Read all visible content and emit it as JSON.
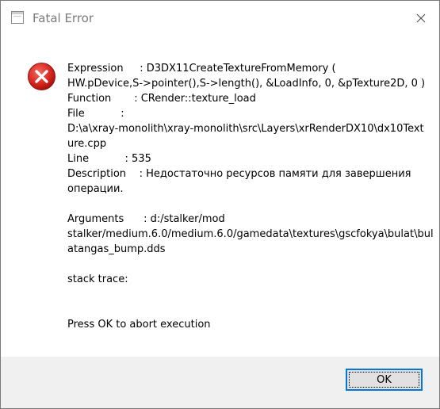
{
  "window": {
    "title": "Fatal Error",
    "close_icon": "close-icon",
    "app_icon": "window-icon"
  },
  "message": {
    "icon": "error-icon",
    "lines": [
      "Expression     : D3DX11CreateTextureFromMemory (",
      "HW.pDevice,S->pointer(),S->length(), &LoadInfo, 0, &pTexture2D, 0 )",
      "Function       : CRender::texture_load",
      "File           :",
      "D:\\a\\xray-monolith\\xray-monolith\\src\\Layers\\xrRenderDX10\\dx10Text",
      "ure.cpp",
      "Line           : 535",
      "Description    : Недостаточно ресурсов памяти для завершения",
      "операции.",
      "",
      "Arguments      : d:/stalker/mod",
      "stalker/medium.6.0/medium.6.0/gamedata\\textures\\gscfokya\\bulat\\bul",
      "atangas_bump.dds",
      "",
      "stack trace:",
      "",
      "",
      "Press OK to abort execution"
    ]
  },
  "buttons": {
    "ok_label": "OK"
  },
  "colors": {
    "accent": "#0078d7",
    "error_red": "#d32f2f",
    "footer_bg": "#f0f0f0",
    "title_gray": "#7a7a7a"
  }
}
